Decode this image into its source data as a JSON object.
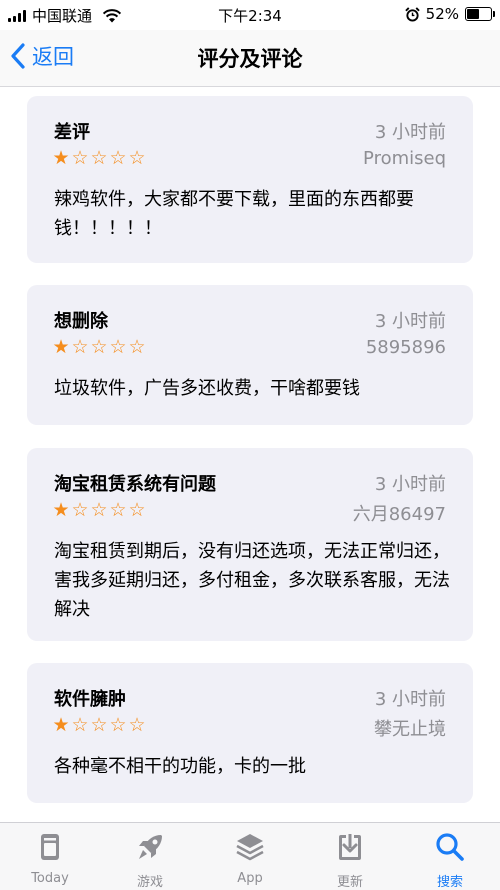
{
  "status_bar": {
    "carrier": "中国联通",
    "time": "下午2:34",
    "battery": "52%",
    "battery_level": 0.52
  },
  "nav": {
    "back_label": "返回",
    "title": "评分及评论"
  },
  "reviews": [
    {
      "title": "差评",
      "time": "3 小时前",
      "author": "Promiseq",
      "rating": 1,
      "body": "辣鸡软件，大家都不要下载，里面的东西都要钱！！！！！"
    },
    {
      "title": "想删除",
      "time": "3 小时前",
      "author": "5895896",
      "rating": 1,
      "body": "垃圾软件，广告多还收费，干啥都要钱"
    },
    {
      "title": "淘宝租赁系统有问题",
      "time": "3 小时前",
      "author": "六月86497",
      "rating": 1,
      "body": "淘宝租赁到期后，没有归还选项，无法正常归还，害我多延期归还，多付租金，多次联系客服，无法解决"
    },
    {
      "title": "软件臃肿",
      "time": "3 小时前",
      "author": "攀无止境",
      "rating": 1,
      "body": "各种毫不相干的功能，卡的一批"
    }
  ],
  "tabs": [
    {
      "label": "Today",
      "icon": "today-icon"
    },
    {
      "label": "游戏",
      "icon": "rocket-icon"
    },
    {
      "label": "App",
      "icon": "app-stack-icon"
    },
    {
      "label": "更新",
      "icon": "download-icon"
    },
    {
      "label": "搜索",
      "icon": "search-icon"
    }
  ],
  "colors": {
    "accent": "#1a7cf5",
    "star": "#f58d1d",
    "card_bg": "#f0f0f7",
    "secondary_text": "#8e8e93"
  }
}
